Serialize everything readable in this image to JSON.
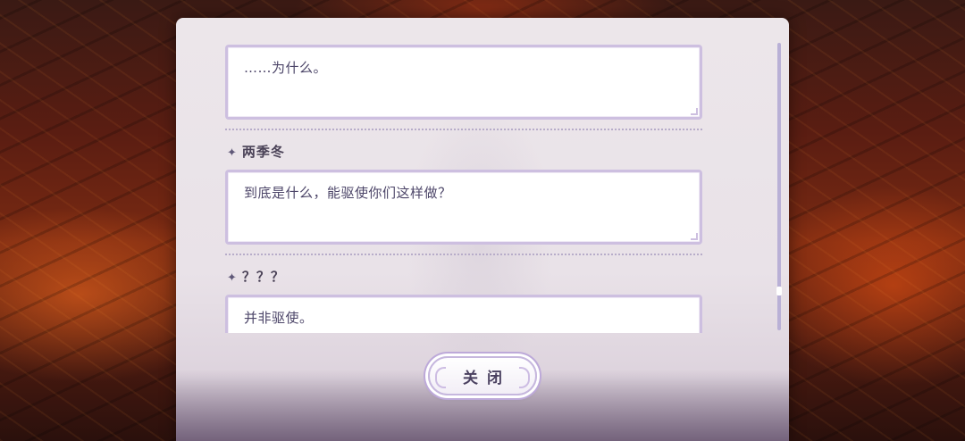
{
  "dialog_log": {
    "entries": [
      {
        "speaker": "",
        "text": "……为什么。"
      },
      {
        "speaker": "两季冬",
        "text": "到底是什么，能驱使你们这样做？"
      },
      {
        "speaker": "？？？",
        "text": "并非驱使。"
      }
    ]
  },
  "close_button": {
    "label": "关闭"
  },
  "icons": {
    "speaker_marker": "four-point-star-icon"
  },
  "colors": {
    "panel_bg": "#ece6ea",
    "box_border": "#cdbfe0",
    "text": "#4c4568",
    "scrollbar": "#b9b0d6"
  }
}
